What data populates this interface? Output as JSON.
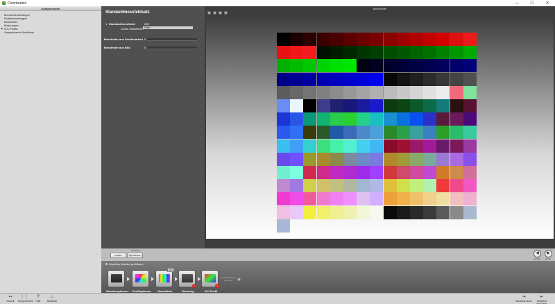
{
  "window": {
    "title": "Colorbration",
    "minimize": "—",
    "maximize": "☐",
    "close": "✕"
  },
  "left_panel": {
    "title": "Komponenten",
    "items": [
      {
        "label": "Monitoreinstellungen",
        "active": false
      },
      {
        "label": "Profileinstellungen",
        "active": false
      },
      {
        "label": "Messfelder",
        "active": false
      },
      {
        "label": "Messungen",
        "active": false
      },
      {
        "label": "ICC-Profile",
        "active": true
      },
      {
        "label": "Gespeicherte Workflows",
        "active": false
      }
    ]
  },
  "settings": {
    "title": "Standardmessfeldsatz",
    "standard_label": "Standardmessfelder",
    "standard_value": "255",
    "size_label": "Größe Messfelder:",
    "size_value": "Mittel",
    "special_label": "Messfelder aus Sonderfarben",
    "special_value": "0",
    "image_label": "Messfelder aus Bild",
    "image_value": "0"
  },
  "preview": {
    "title": "Messfelder",
    "tools": [
      "grid-tool-icon",
      "list-tool-icon",
      "zoom-tool-icon",
      "info-tool-icon"
    ],
    "rows": [
      [
        "#000000",
        "#1a0000",
        "#2a0000",
        "#3a0000",
        "#4a0000",
        "#5a0000",
        "#6a0000",
        "#7a0000",
        "#8c0000",
        "#9e0000",
        "#b00000",
        "#c20000",
        "#d40000",
        "#e01010",
        "#ee1a1a"
      ],
      [
        "#e81212",
        "#f01818",
        "#f41c1c",
        "#001000",
        "#001c00",
        "#002800",
        "#003400",
        "#004000",
        "#004c00",
        "#005800",
        "#006400",
        "#007000",
        "#008200",
        "#009600",
        "#00aa00"
      ],
      [
        "#00b000",
        "#00bc00",
        "#00c800",
        "#00d400",
        "#00e000",
        "#00e600",
        "#000014",
        "#000020",
        "#00002c",
        "#000038",
        "#000044",
        "#000050",
        "#00005c",
        "#00006a",
        "#000078"
      ],
      [
        "#000086",
        "#000094",
        "#0000a2",
        "#0000b0",
        "#0000be",
        "#0000cc",
        "#0000dc",
        "#0000f0",
        "#080808",
        "#141414",
        "#202020",
        "#2c2c2c",
        "#383838",
        "#444444",
        "#505050"
      ],
      [
        "#5c5c5c",
        "#686868",
        "#747474",
        "#808080",
        "#8c8c8c",
        "#989898",
        "#a4a4a4",
        "#b0b0b0",
        "#bcbcbc",
        "#c8c8c8",
        "#d4d4d4",
        "#e0e0e0",
        "#ececec",
        "#f3687a",
        "#7fe39a"
      ],
      [
        "#6b8cf5",
        "#eaf6ff",
        "#000000",
        "#3c3c8c",
        "#202070",
        "#181878",
        "#1a1aa0",
        "#1a1acc",
        "#0e3a10",
        "#0c4412",
        "#0a5a2a",
        "#0a6a4a",
        "#147a7a",
        "#2a1010",
        "#5a1030"
      ],
      [
        "#1a36d6",
        "#2a56e6",
        "#0a9a7a",
        "#12b270",
        "#2acc4a",
        "#2ad030",
        "#24d08a",
        "#1ac0c0",
        "#1a90d0",
        "#0a70e0",
        "#0a50f0",
        "#2a30c8",
        "#5a1a3a",
        "#6a1a5a",
        "#4a0a7a"
      ],
      [
        "#2a5af0",
        "#3070f6",
        "#3a3a0a",
        "#2a5a2a",
        "#205aa8",
        "#3a6ab8",
        "#4a8ac8",
        "#4aa0d8",
        "#2a8a2a",
        "#2aa04a",
        "#3aa0a0",
        "#3a80c0",
        "#2aa02a",
        "#2abc6a",
        "#3acaa0"
      ],
      [
        "#3ac0f0",
        "#40a0f8",
        "#34d0d0",
        "#3ae07a",
        "#44f0aa",
        "#50f0d0",
        "#44d0f0",
        "#40b8f4",
        "#8a0a2a",
        "#a01030",
        "#9a1a6a",
        "#a01a9a",
        "#6a1a6a",
        "#7a1a5a",
        "#9a3aa0"
      ],
      [
        "#6a4aea",
        "#7050ff",
        "#9a9a2a",
        "#aa8a2a",
        "#8a8a4a",
        "#7a8aa0",
        "#6a8ac8",
        "#7a7ae0",
        "#b08a2a",
        "#a09a3a",
        "#8aaa6a",
        "#7aaa9a",
        "#9a7ad0",
        "#aa6ae0",
        "#8a50ea"
      ],
      [
        "#70f0d0",
        "#80ffe0",
        "#d02a50",
        "#d02a8a",
        "#c02ac0",
        "#b02ad0",
        "#a02aea",
        "#a040ff",
        "#d03a3a",
        "#d04a6a",
        "#d04aa0",
        "#c04ad0",
        "#d07a2a",
        "#d08a4a",
        "#d0709a"
      ],
      [
        "#c08ad0",
        "#a07ae0",
        "#d0d04a",
        "#d0c06a",
        "#c0c080",
        "#b0b8a0",
        "#a0b8d0",
        "#b0b8e8",
        "#e0c03a",
        "#d0e04a",
        "#c0f07a",
        "#b0f0b0",
        "#f03a3a",
        "#f04a8a",
        "#f05ac0"
      ],
      [
        "#f03ad0",
        "#f04ae8",
        "#f05a9a",
        "#f07ad0",
        "#f080f0",
        "#f090ff",
        "#e0c0f0",
        "#d0b0ff",
        "#f0a03a",
        "#f0b04a",
        "#f0c06a",
        "#f0d08a",
        "#f0e0a0",
        "#f0c0c0",
        "#f0b0d0"
      ],
      [
        "#f0c0e0",
        "#e8c8f8",
        "#f0f03a",
        "#f0f06a",
        "#f0f090",
        "#f0f0b0",
        "#f0f8d8",
        "#f8f8f0",
        "#0a0a0a",
        "#1a1a1a",
        "#2a2a2a",
        "#3a3a3a",
        "#5a5a5a",
        "#8a8a8a",
        "#aab8d0"
      ],
      [
        "#aab8d8"
      ]
    ]
  },
  "bottom": {
    "group_label": "Einstellen",
    "load_label": "Laden",
    "save_label": "Speichern",
    "back_label": "Zurück",
    "next_label": "Weiter"
  },
  "workflow": {
    "title": "Workflow Monitor profilieren",
    "steps": [
      {
        "label": "Monitoroptionen",
        "badge": ""
      },
      {
        "label": "Profiloptionen",
        "badge": ""
      },
      {
        "label": "Messfelder",
        "badge": "",
        "tag": "NEU"
      },
      {
        "label": "Messung",
        "badge": "?"
      },
      {
        "label": "ICC-Profil",
        "badge": "?"
      }
    ],
    "optional_label": "Profilbewertung (optional)"
  },
  "statusbar": {
    "left": [
      {
        "icon": "↤",
        "label": "Indizell"
      },
      {
        "icon": "⋮⋮",
        "label": "Komponenten"
      },
      {
        "icon": "?",
        "label": "Hilfe"
      },
      {
        "icon": "⌂",
        "label": "Startseite"
      }
    ],
    "right": [
      {
        "icon": "⇥",
        "label": "Workflow laden"
      },
      {
        "icon": "⇤",
        "label": "Workflow speichern"
      }
    ]
  }
}
